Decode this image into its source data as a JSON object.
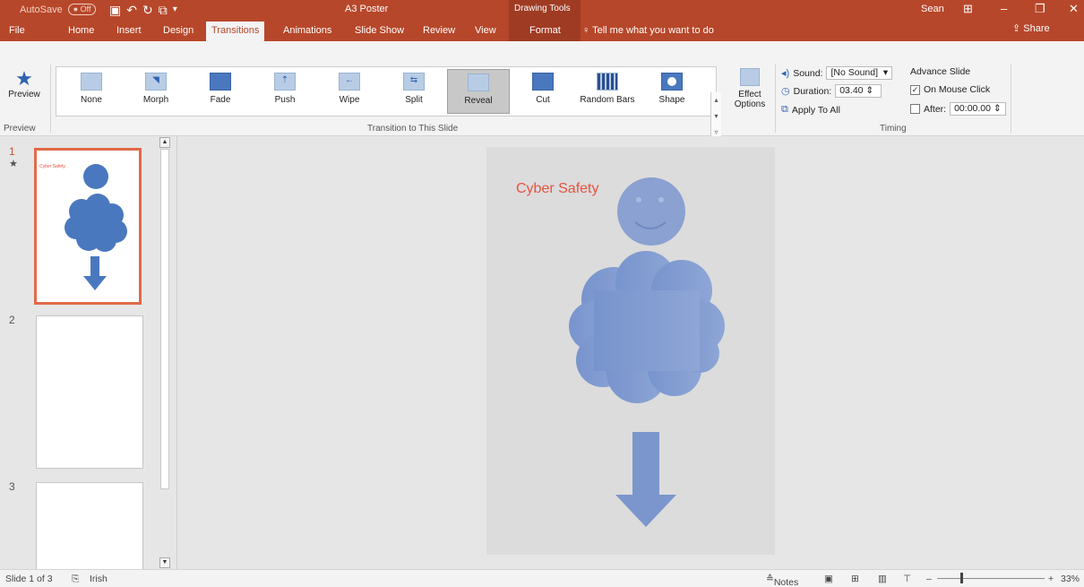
{
  "titlebar": {
    "autosave_label": "AutoSave",
    "autosave_state": "Off",
    "doc_title": "A3 Poster",
    "context_group": "Drawing Tools",
    "user": "Sean"
  },
  "tabs": [
    "File",
    "Home",
    "Insert",
    "Design",
    "Transitions",
    "Animations",
    "Slide Show",
    "Review",
    "View",
    "Format"
  ],
  "active_tab": "Transitions",
  "tell_me": "Tell me what you want to do",
  "share": "Share",
  "ribbon": {
    "preview_label": "Preview",
    "preview_group": "Preview",
    "transitions": [
      "None",
      "Morph",
      "Fade",
      "Push",
      "Wipe",
      "Split",
      "Reveal",
      "Cut",
      "Random Bars",
      "Shape"
    ],
    "selected_transition": "Reveal",
    "effect_options": "Effect Options",
    "group_transition": "Transition to This Slide",
    "sound_label": "Sound:",
    "sound_value": "[No Sound]",
    "duration_label": "Duration:",
    "duration_value": "03.40",
    "apply_all": "Apply To All",
    "advance_label": "Advance Slide",
    "on_mouse_click": "On Mouse Click",
    "after_label": "After:",
    "after_value": "00:00.00",
    "group_timing": "Timing"
  },
  "slides": [
    {
      "number": "1",
      "title": "Cyber Safety"
    },
    {
      "number": "2"
    },
    {
      "number": "3"
    }
  ],
  "slide_title": "Cyber Safety",
  "status": {
    "slide_info": "Slide 1 of 3",
    "language": "Irish",
    "notes": "Notes",
    "zoom": "33%"
  },
  "colors": {
    "accent": "#b7472a",
    "title_red": "#e8523f",
    "shape_blue": "#4a78bf"
  }
}
